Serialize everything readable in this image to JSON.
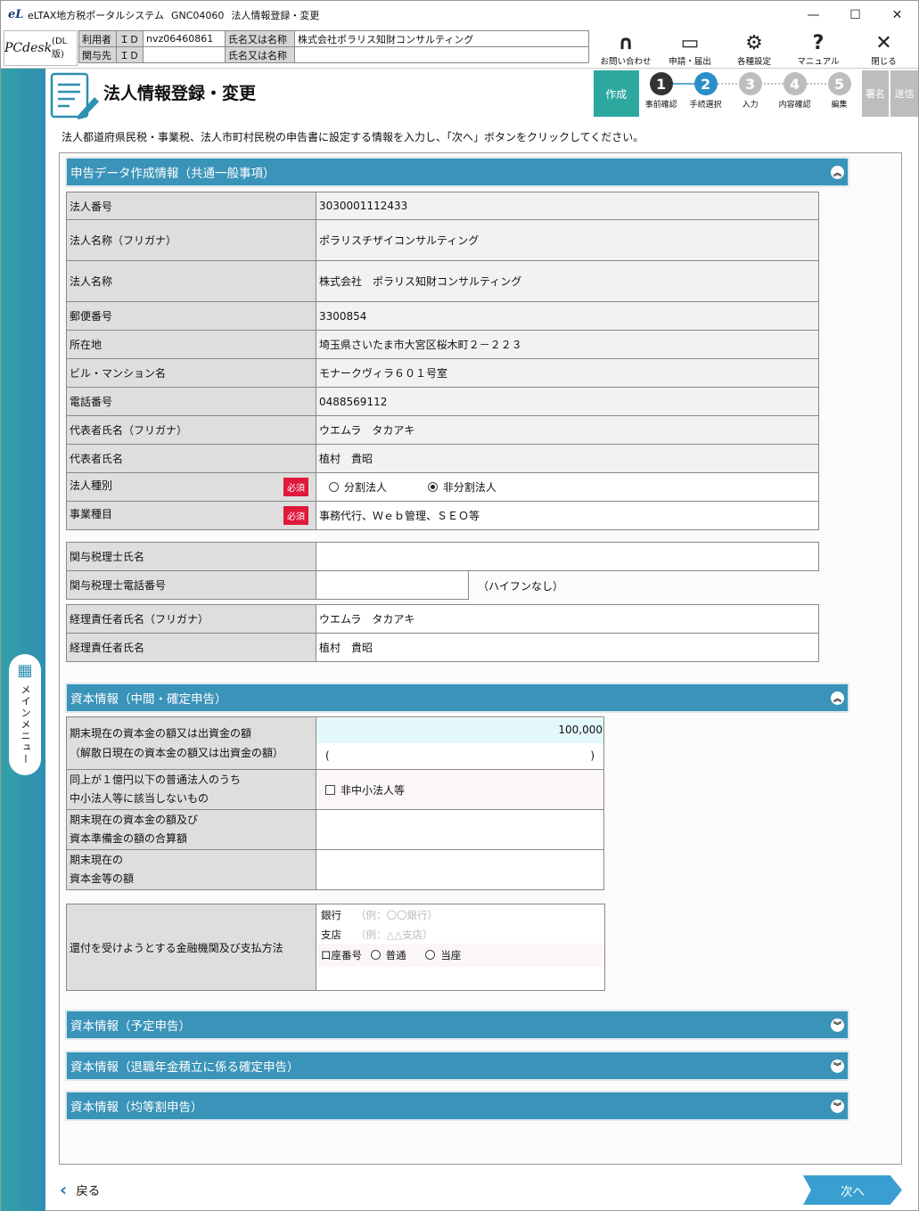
{
  "window": {
    "title_parts": [
      "eLTAX地方税ポータルシステム",
      "GNC04060",
      "法人情報登録・変更"
    ],
    "minimize": "—",
    "maximize": "☐",
    "close": "✕"
  },
  "header": {
    "logo": "PCdesk",
    "logo_suffix": "(DL版)",
    "user_label": "利用者",
    "id_label": "ＩＤ",
    "user_id": "nvz06460861",
    "name_label": "氏名又は名称",
    "user_name": "株式会社ポラリス知財コンサルティング",
    "related_label": "関与先",
    "related_id": "",
    "related_name": "",
    "buttons": [
      {
        "label": "お問い合わせ",
        "icon": "headset-icon",
        "glyph": "🎧"
      },
      {
        "label": "申請・届出",
        "icon": "window-icon",
        "glyph": "▭"
      },
      {
        "label": "各種設定",
        "icon": "gear-icon",
        "glyph": "⚙"
      },
      {
        "label": "マニュアル",
        "icon": "question-icon",
        "glyph": "?"
      },
      {
        "label": "閉じる",
        "icon": "close-icon",
        "glyph": "✕"
      }
    ]
  },
  "sidebar": {
    "menu_label": "メインメニュー",
    "menu_icon": "grid-icon"
  },
  "page": {
    "title": "法人情報登録・変更",
    "intro": "法人都道府県民税・事業税、法人市町村民税の申告書に設定する情報を入力し、「次へ」ボタンをクリックしてください。"
  },
  "steps": {
    "create": "作成",
    "items": [
      {
        "num": "1",
        "label": "事前確認",
        "color": "#333333"
      },
      {
        "num": "2",
        "label": "手続選択",
        "color": "#2a8fc8"
      },
      {
        "num": "3",
        "label": "入力",
        "color": "#bdbdbd"
      },
      {
        "num": "4",
        "label": "内容確認",
        "color": "#bdbdbd"
      },
      {
        "num": "5",
        "label": "編集",
        "color": "#bdbdbd"
      }
    ],
    "sign": "署名",
    "send": "送信"
  },
  "sections": {
    "common": "申告データ作成情報（共通一般事項）",
    "capital_interim": "資本情報（中間・確定申告）",
    "capital_planned": "資本情報（予定申告）",
    "capital_pension": "資本情報（退職年金積立に係る確定申告）",
    "capital_equal": "資本情報（均等割申告）"
  },
  "common": {
    "corp_number_label": "法人番号",
    "corp_number": "3030001112433",
    "corp_kana_label": "法人名称（フリガナ）",
    "corp_kana": "ポラリスチザイコンサルティング",
    "corp_name_label": "法人名称",
    "corp_name": "株式会社　ポラリス知財コンサルティング",
    "postal_label": "郵便番号",
    "postal": "3300854",
    "address_label": "所在地",
    "address": "埼玉県さいたま市大宮区桜木町２－２２３",
    "building_label": "ビル・マンション名",
    "building": "モナークヴィラ６０１号室",
    "phone_label": "電話番号",
    "phone": "0488569112",
    "rep_kana_label": "代表者氏名（フリガナ）",
    "rep_kana": "ウエムラ　タカアキ",
    "rep_name_label": "代表者氏名",
    "rep_name": "植村　貴昭",
    "corp_type_label": "法人種別",
    "required": "必須",
    "corp_type_opt1": "分割法人",
    "corp_type_opt2": "非分割法人",
    "corp_type_selected": "非分割法人",
    "business_label": "事業種目",
    "business": "事務代行、Ｗｅｂ管理、ＳＥＯ等",
    "tax_acct_label": "関与税理士氏名",
    "tax_acct": "",
    "tax_acct_phone_label": "関与税理士電話番号",
    "tax_acct_phone": "",
    "tax_acct_phone_note": "（ハイフンなし）",
    "acct_mgr_kana_label": "経理責任者氏名（フリガナ）",
    "acct_mgr_kana": "ウエムラ　タカアキ",
    "acct_mgr_label": "経理責任者氏名",
    "acct_mgr": "植村　貴昭"
  },
  "capital": {
    "capital_label_1": "期末現在の資本金の額又は出資金の額",
    "capital_label_2": "（解散日現在の資本金の額又は出資金の額）",
    "capital_value": "100,000",
    "paren_open": "(",
    "paren_close": ")",
    "sme_label_1": "同上が１億円以下の普通法人のうち",
    "sme_label_2": "中小法人等に該当しないもの",
    "sme_check": "非中小法人等",
    "reserve_label_1": "期末現在の資本金の額及び",
    "reserve_label_2": "資本準備金の額の合算額",
    "cap_etc_label_1": "期末現在の",
    "cap_etc_label_2": "資本金等の額",
    "refund_label": "還付を受けようとする金融機関及び支払方法",
    "bank_label": "銀行",
    "bank_ph": "（例：〇〇銀行）",
    "branch_label": "支店",
    "branch_ph": "（例：△△支店）",
    "account_label": "口座番号",
    "account_opt1": "普通",
    "account_opt2": "当座"
  },
  "footer": {
    "back": "戻る",
    "next": "次へ"
  }
}
